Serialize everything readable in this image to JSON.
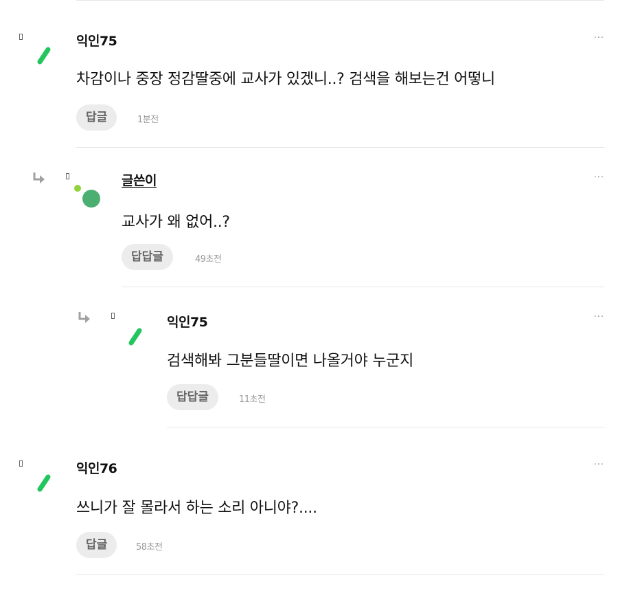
{
  "comments": [
    {
      "author": "익인75",
      "text": "차감이나 중장 정감딸중에 교사가 있겠니..? 검색을 해보는건 어떻니",
      "reply_label": "답글",
      "time": "1분전",
      "more": "···",
      "avatar": "green-slash"
    },
    {
      "author": "글쓴이",
      "text": "교사가 왜 없어..?",
      "reply_label": "답답글",
      "time": "49초전",
      "more": "···",
      "avatar": "green-dot"
    },
    {
      "author": "익인75",
      "text": "검색해봐 그분들딸이면 나올거야 누군지",
      "reply_label": "답답글",
      "time": "11초전",
      "more": "···",
      "avatar": "green-slash"
    },
    {
      "author": "익인76",
      "text": "쓰니가 잘 몰라서 하는 소리 아니야?....",
      "reply_label": "답글",
      "time": "58초전",
      "more": "···",
      "avatar": "green-slash"
    }
  ],
  "colors": {
    "avatar_green": "#22c55e",
    "writer_green": "#4caf72",
    "writer_dot": "#8fd43a"
  }
}
